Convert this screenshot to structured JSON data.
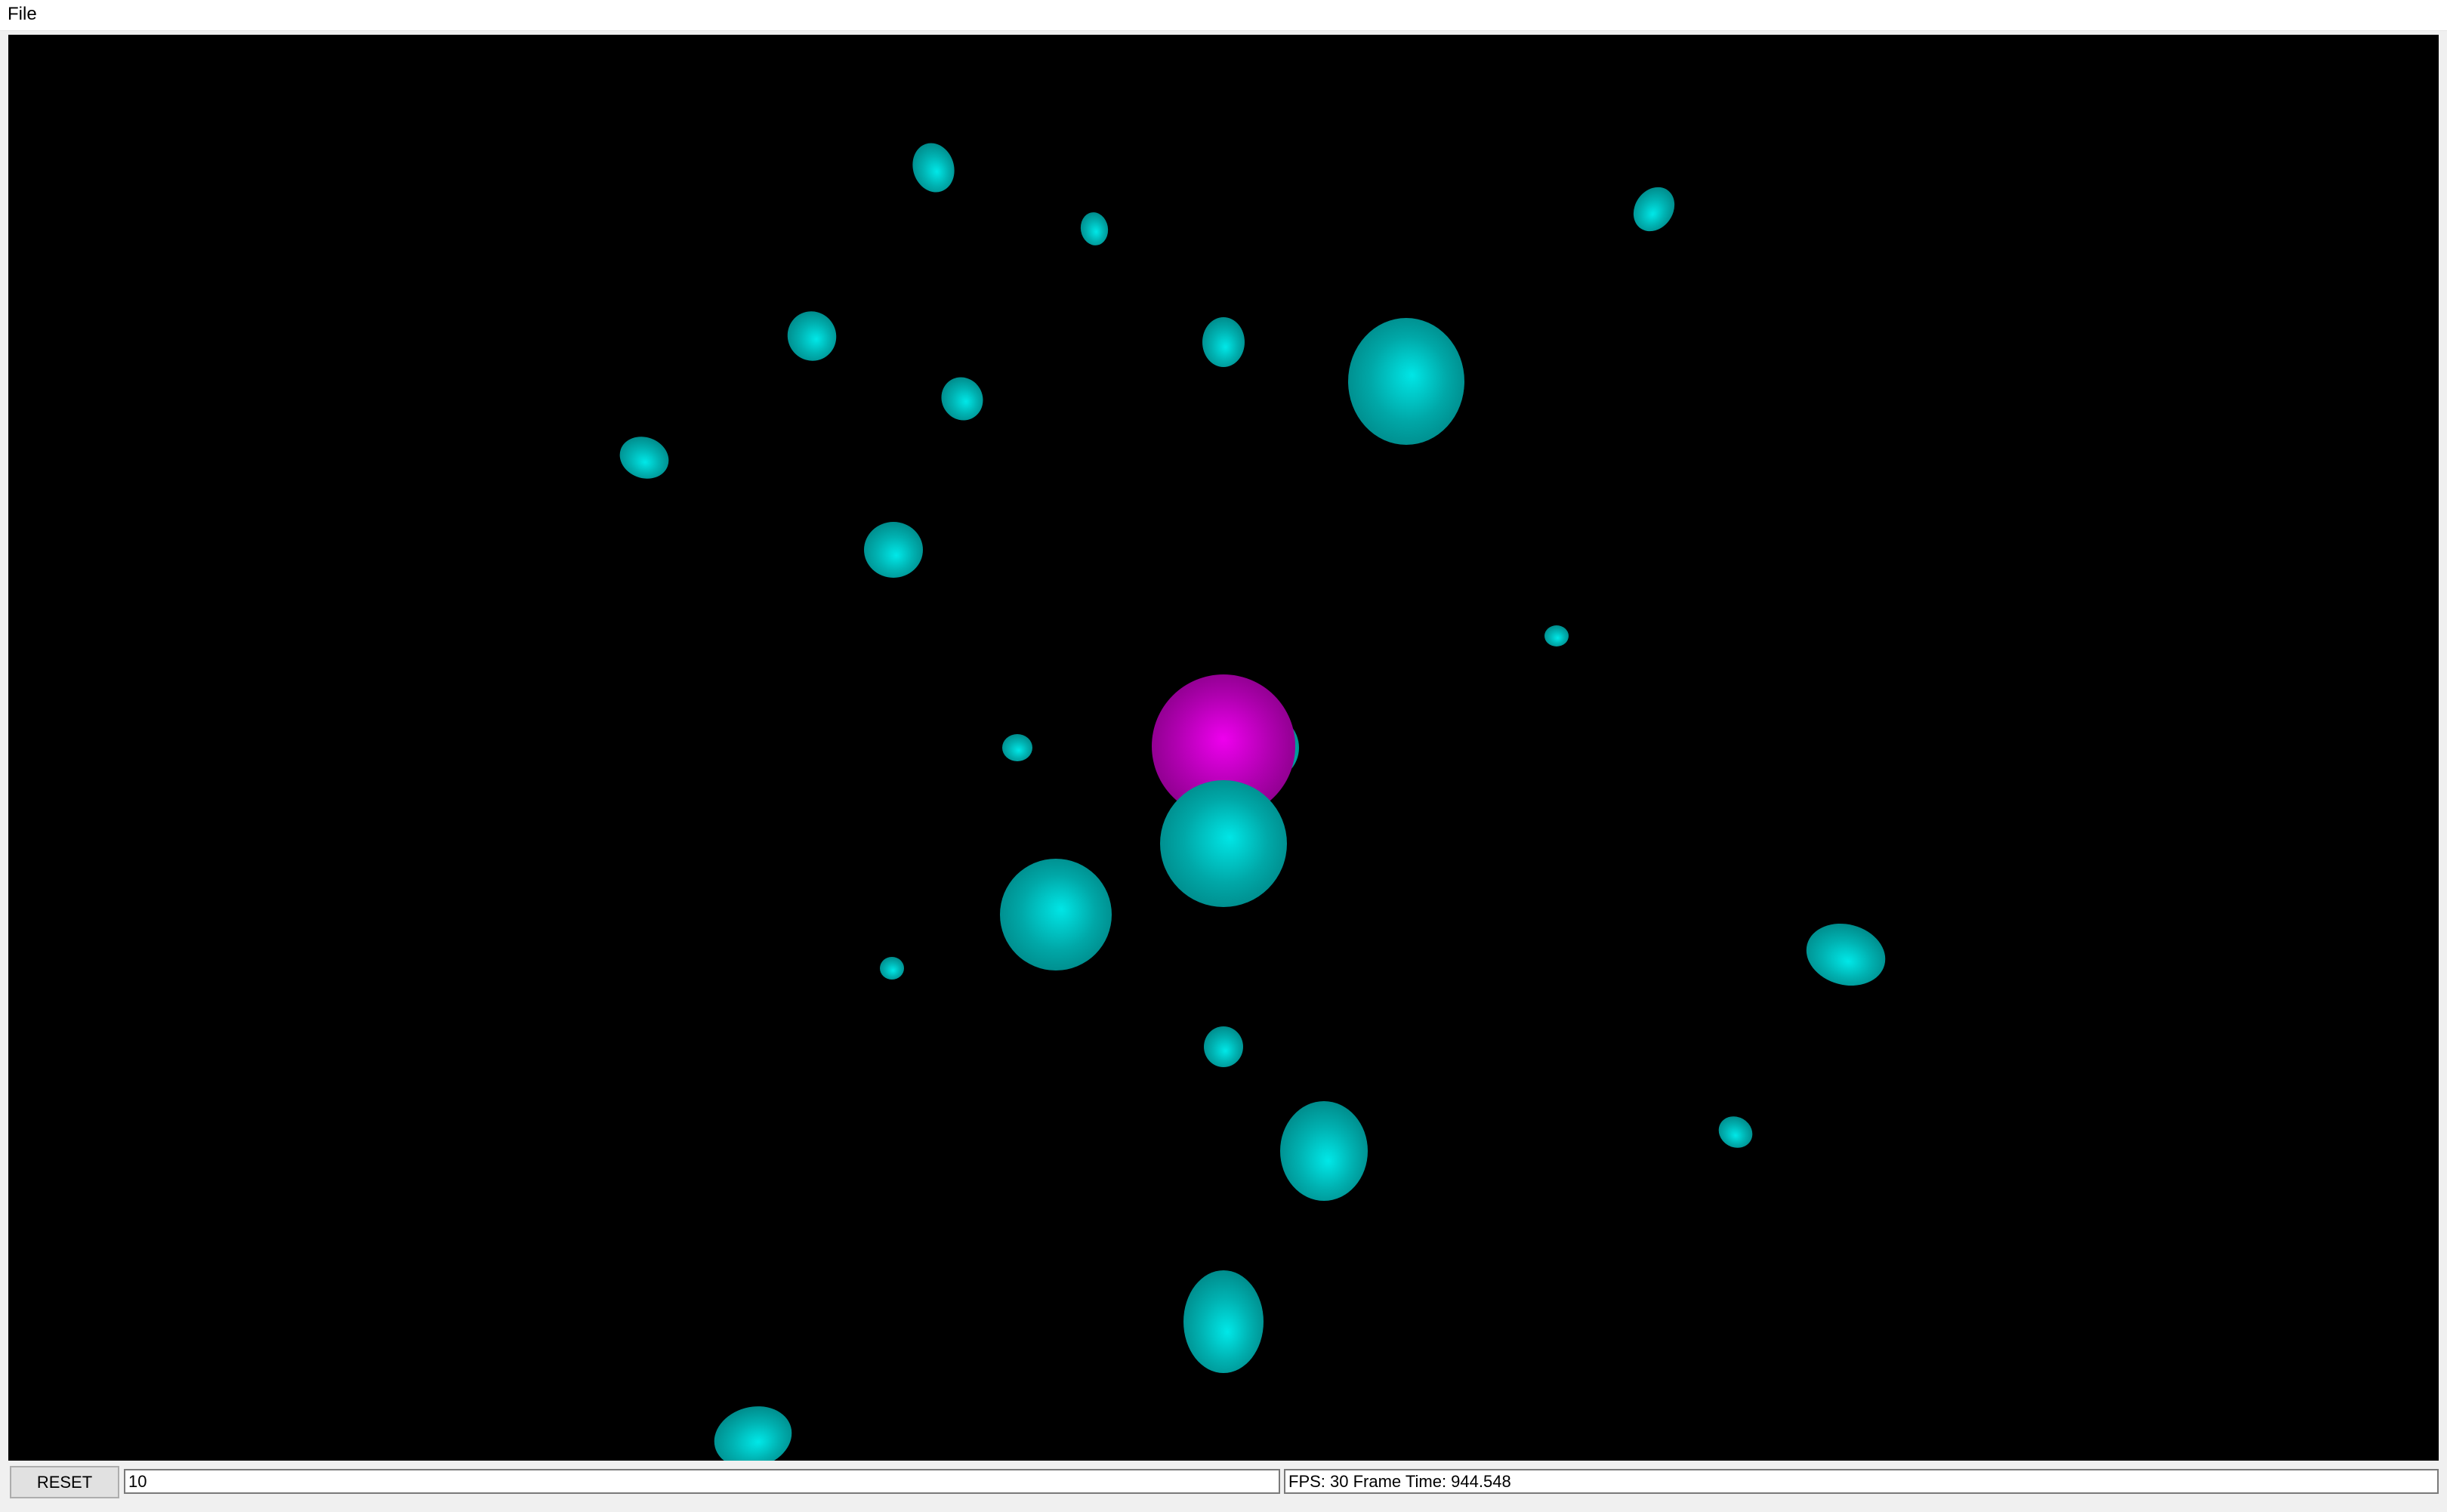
{
  "menubar": {
    "file_label": "File"
  },
  "scene": {
    "background_color": "#000000",
    "primary_sphere_color": "#cc00cc",
    "secondary_sphere_color": "#00c8c8",
    "spheres": [
      {
        "name": "sphere-1",
        "color": "cyan"
      },
      {
        "name": "sphere-2",
        "color": "cyan"
      },
      {
        "name": "sphere-3",
        "color": "cyan"
      },
      {
        "name": "sphere-4",
        "color": "cyan"
      },
      {
        "name": "sphere-5",
        "color": "cyan"
      },
      {
        "name": "sphere-6",
        "color": "cyan"
      },
      {
        "name": "sphere-7",
        "color": "cyan"
      },
      {
        "name": "sphere-8",
        "color": "cyan"
      },
      {
        "name": "sphere-9",
        "color": "cyan"
      },
      {
        "name": "sphere-10",
        "color": "cyan"
      },
      {
        "name": "sphere-11",
        "color": "cyan"
      },
      {
        "name": "sphere-12",
        "color": "magenta"
      },
      {
        "name": "sphere-13",
        "color": "cyan"
      },
      {
        "name": "sphere-14",
        "color": "cyan"
      },
      {
        "name": "sphere-15",
        "color": "cyan"
      },
      {
        "name": "sphere-16",
        "color": "cyan"
      },
      {
        "name": "sphere-17",
        "color": "cyan"
      },
      {
        "name": "sphere-18",
        "color": "cyan"
      },
      {
        "name": "sphere-19",
        "color": "cyan"
      },
      {
        "name": "sphere-20",
        "color": "cyan"
      },
      {
        "name": "sphere-21",
        "color": "cyan"
      },
      {
        "name": "sphere-22",
        "color": "cyan"
      },
      {
        "name": "sphere-23",
        "color": "cyan"
      }
    ]
  },
  "controls": {
    "reset_label": "RESET",
    "count_value": "10",
    "status_text": "FPS: 30 Frame Time: 944.548"
  }
}
